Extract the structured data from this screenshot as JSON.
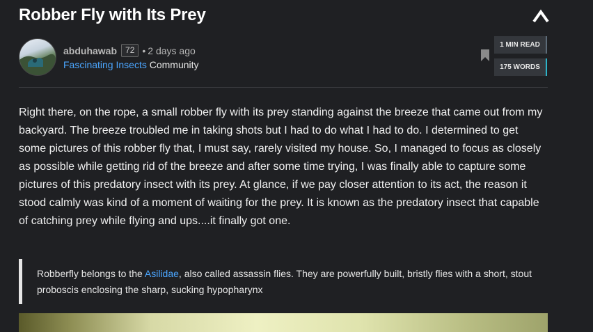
{
  "post": {
    "title": "Robber Fly with Its Prey",
    "author": "abduhawab",
    "reputation": "72",
    "separator": "•",
    "time_ago": "2 days ago",
    "community_name": "Fascinating Insects",
    "community_suffix": "Community",
    "stats": {
      "read_time": "1 MIN READ",
      "word_count": "175 WORDS"
    },
    "body": "Right there, on the rope, a small robber fly with its prey standing against the breeze that came out from my backyard. The breeze troubled me in taking shots but I had to do what I had to do. I determined to get some pictures of this robber fly that, I must say, rarely visited my house. So, I managed to focus as closely as possible while getting rid of the breeze and after some time trying, I was finally able to capture some pictures of this predatory insect with its prey. At glance, if we pay closer attention to its act, the reason it stood calmly was kind of a moment of waiting for the prey. It is known as the predatory insect that capable of catching prey while flying and ups....it finally got one.",
    "quote": {
      "prefix": "Robberfly belongs to the ",
      "link_text": "Asilidae",
      "suffix": ", also called assassin flies. They are powerfully built, bristly flies with a short, stout proboscis enclosing the sharp, sucking hypopharynx"
    }
  },
  "icons": {
    "collapse": "chevron-up-icon",
    "bookmark": "bookmark-icon"
  },
  "colors": {
    "background": "#1f2023",
    "link": "#4ba6ff",
    "words_accent": "#2db3c8"
  }
}
